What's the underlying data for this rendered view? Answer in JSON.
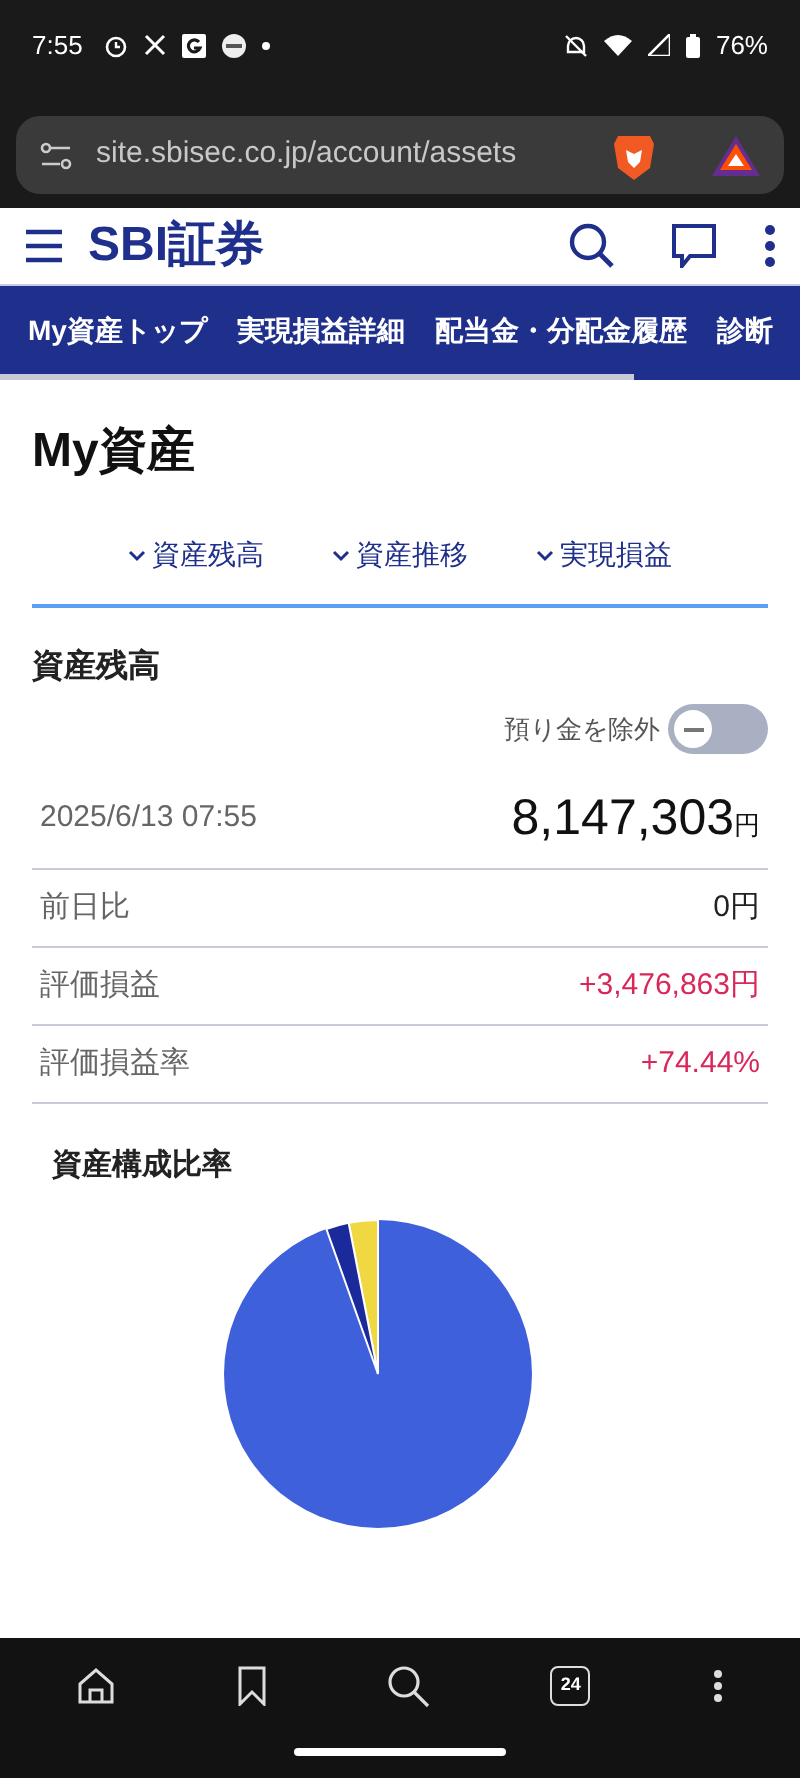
{
  "status_bar": {
    "time": "7:55",
    "battery": "76%"
  },
  "browser": {
    "url": "site.sbisec.co.jp/account/assets"
  },
  "header": {
    "logo": "SBI証券"
  },
  "nav_tabs": [
    {
      "label": "My資産トップ"
    },
    {
      "label": "実現損益詳細"
    },
    {
      "label": "配当金・分配金履歴"
    },
    {
      "label": "診断"
    }
  ],
  "page_title": "My資産",
  "section_links": [
    {
      "label": "資産残高"
    },
    {
      "label": "資産推移"
    },
    {
      "label": "実現損益"
    }
  ],
  "section_title": "資産残高",
  "toggle": {
    "label": "預り金を除外",
    "on": false
  },
  "total": {
    "date": "2025/6/13 07:55",
    "amount": "8,147,303",
    "unit": "円"
  },
  "rows": [
    {
      "label": "前日比",
      "value": "0円",
      "kind": "neutral"
    },
    {
      "label": "評価損益",
      "value": "+3,476,863円",
      "kind": "gain"
    },
    {
      "label": "評価損益率",
      "value": "+74.44%",
      "kind": "gain"
    }
  ],
  "composition_title": "資産構成比率",
  "bottom_bar": {
    "tab_count": "24"
  }
}
